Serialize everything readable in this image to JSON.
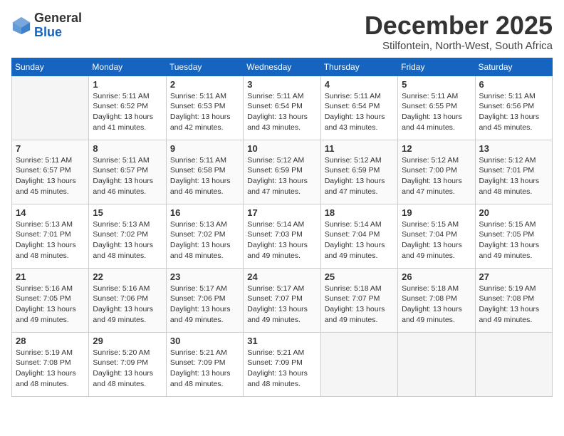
{
  "logo": {
    "general": "General",
    "blue": "Blue"
  },
  "title": "December 2025",
  "subtitle": "Stilfontein, North-West, South Africa",
  "weekdays": [
    "Sunday",
    "Monday",
    "Tuesday",
    "Wednesday",
    "Thursday",
    "Friday",
    "Saturday"
  ],
  "weeks": [
    [
      {
        "day": "",
        "sunrise": "",
        "sunset": "",
        "daylight": ""
      },
      {
        "day": "1",
        "sunrise": "Sunrise: 5:11 AM",
        "sunset": "Sunset: 6:52 PM",
        "daylight": "Daylight: 13 hours and 41 minutes."
      },
      {
        "day": "2",
        "sunrise": "Sunrise: 5:11 AM",
        "sunset": "Sunset: 6:53 PM",
        "daylight": "Daylight: 13 hours and 42 minutes."
      },
      {
        "day": "3",
        "sunrise": "Sunrise: 5:11 AM",
        "sunset": "Sunset: 6:54 PM",
        "daylight": "Daylight: 13 hours and 43 minutes."
      },
      {
        "day": "4",
        "sunrise": "Sunrise: 5:11 AM",
        "sunset": "Sunset: 6:54 PM",
        "daylight": "Daylight: 13 hours and 43 minutes."
      },
      {
        "day": "5",
        "sunrise": "Sunrise: 5:11 AM",
        "sunset": "Sunset: 6:55 PM",
        "daylight": "Daylight: 13 hours and 44 minutes."
      },
      {
        "day": "6",
        "sunrise": "Sunrise: 5:11 AM",
        "sunset": "Sunset: 6:56 PM",
        "daylight": "Daylight: 13 hours and 45 minutes."
      }
    ],
    [
      {
        "day": "7",
        "sunrise": "Sunrise: 5:11 AM",
        "sunset": "Sunset: 6:57 PM",
        "daylight": "Daylight: 13 hours and 45 minutes."
      },
      {
        "day": "8",
        "sunrise": "Sunrise: 5:11 AM",
        "sunset": "Sunset: 6:57 PM",
        "daylight": "Daylight: 13 hours and 46 minutes."
      },
      {
        "day": "9",
        "sunrise": "Sunrise: 5:11 AM",
        "sunset": "Sunset: 6:58 PM",
        "daylight": "Daylight: 13 hours and 46 minutes."
      },
      {
        "day": "10",
        "sunrise": "Sunrise: 5:12 AM",
        "sunset": "Sunset: 6:59 PM",
        "daylight": "Daylight: 13 hours and 47 minutes."
      },
      {
        "day": "11",
        "sunrise": "Sunrise: 5:12 AM",
        "sunset": "Sunset: 6:59 PM",
        "daylight": "Daylight: 13 hours and 47 minutes."
      },
      {
        "day": "12",
        "sunrise": "Sunrise: 5:12 AM",
        "sunset": "Sunset: 7:00 PM",
        "daylight": "Daylight: 13 hours and 47 minutes."
      },
      {
        "day": "13",
        "sunrise": "Sunrise: 5:12 AM",
        "sunset": "Sunset: 7:01 PM",
        "daylight": "Daylight: 13 hours and 48 minutes."
      }
    ],
    [
      {
        "day": "14",
        "sunrise": "Sunrise: 5:13 AM",
        "sunset": "Sunset: 7:01 PM",
        "daylight": "Daylight: 13 hours and 48 minutes."
      },
      {
        "day": "15",
        "sunrise": "Sunrise: 5:13 AM",
        "sunset": "Sunset: 7:02 PM",
        "daylight": "Daylight: 13 hours and 48 minutes."
      },
      {
        "day": "16",
        "sunrise": "Sunrise: 5:13 AM",
        "sunset": "Sunset: 7:02 PM",
        "daylight": "Daylight: 13 hours and 48 minutes."
      },
      {
        "day": "17",
        "sunrise": "Sunrise: 5:14 AM",
        "sunset": "Sunset: 7:03 PM",
        "daylight": "Daylight: 13 hours and 49 minutes."
      },
      {
        "day": "18",
        "sunrise": "Sunrise: 5:14 AM",
        "sunset": "Sunset: 7:04 PM",
        "daylight": "Daylight: 13 hours and 49 minutes."
      },
      {
        "day": "19",
        "sunrise": "Sunrise: 5:15 AM",
        "sunset": "Sunset: 7:04 PM",
        "daylight": "Daylight: 13 hours and 49 minutes."
      },
      {
        "day": "20",
        "sunrise": "Sunrise: 5:15 AM",
        "sunset": "Sunset: 7:05 PM",
        "daylight": "Daylight: 13 hours and 49 minutes."
      }
    ],
    [
      {
        "day": "21",
        "sunrise": "Sunrise: 5:16 AM",
        "sunset": "Sunset: 7:05 PM",
        "daylight": "Daylight: 13 hours and 49 minutes."
      },
      {
        "day": "22",
        "sunrise": "Sunrise: 5:16 AM",
        "sunset": "Sunset: 7:06 PM",
        "daylight": "Daylight: 13 hours and 49 minutes."
      },
      {
        "day": "23",
        "sunrise": "Sunrise: 5:17 AM",
        "sunset": "Sunset: 7:06 PM",
        "daylight": "Daylight: 13 hours and 49 minutes."
      },
      {
        "day": "24",
        "sunrise": "Sunrise: 5:17 AM",
        "sunset": "Sunset: 7:07 PM",
        "daylight": "Daylight: 13 hours and 49 minutes."
      },
      {
        "day": "25",
        "sunrise": "Sunrise: 5:18 AM",
        "sunset": "Sunset: 7:07 PM",
        "daylight": "Daylight: 13 hours and 49 minutes."
      },
      {
        "day": "26",
        "sunrise": "Sunrise: 5:18 AM",
        "sunset": "Sunset: 7:08 PM",
        "daylight": "Daylight: 13 hours and 49 minutes."
      },
      {
        "day": "27",
        "sunrise": "Sunrise: 5:19 AM",
        "sunset": "Sunset: 7:08 PM",
        "daylight": "Daylight: 13 hours and 49 minutes."
      }
    ],
    [
      {
        "day": "28",
        "sunrise": "Sunrise: 5:19 AM",
        "sunset": "Sunset: 7:08 PM",
        "daylight": "Daylight: 13 hours and 48 minutes."
      },
      {
        "day": "29",
        "sunrise": "Sunrise: 5:20 AM",
        "sunset": "Sunset: 7:09 PM",
        "daylight": "Daylight: 13 hours and 48 minutes."
      },
      {
        "day": "30",
        "sunrise": "Sunrise: 5:21 AM",
        "sunset": "Sunset: 7:09 PM",
        "daylight": "Daylight: 13 hours and 48 minutes."
      },
      {
        "day": "31",
        "sunrise": "Sunrise: 5:21 AM",
        "sunset": "Sunset: 7:09 PM",
        "daylight": "Daylight: 13 hours and 48 minutes."
      },
      {
        "day": "",
        "sunrise": "",
        "sunset": "",
        "daylight": ""
      },
      {
        "day": "",
        "sunrise": "",
        "sunset": "",
        "daylight": ""
      },
      {
        "day": "",
        "sunrise": "",
        "sunset": "",
        "daylight": ""
      }
    ]
  ]
}
